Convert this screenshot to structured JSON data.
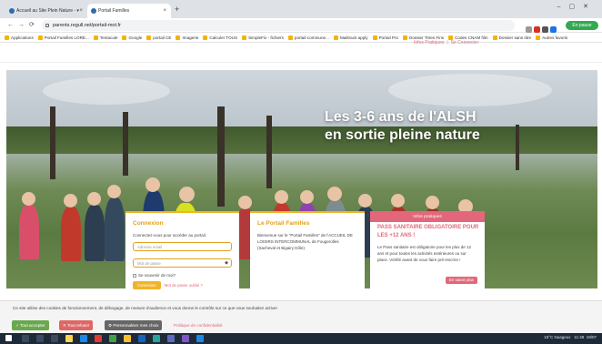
{
  "browser": {
    "tabs": [
      {
        "label": "Accueil au Site Plein Nature - ▾"
      },
      {
        "label": "Portail Familles"
      }
    ],
    "new_tab": "+",
    "url": "parents.regull.net/portail-mot.fr",
    "pause_label": "En pause",
    "bookmarks": [
      "Applications",
      "Portail Familles LORE...",
      "Tentacule",
      "Google",
      "portail CE",
      "Imagerie",
      "Calculer TOUS",
      "SimpleFix - fichiers",
      "portail-commune...",
      "Mailtrack apply",
      "Portail Pro",
      "Dossier Titres Fins",
      "Codes CNAM film",
      "Dossier sans titre",
      "Autres favoris"
    ]
  },
  "site": {
    "top_links": [
      "Infos Pratiques",
      "Se Connecter"
    ],
    "top_sep": "|",
    "hero_title_line1": "Les 3-6 ans de l'ALSH",
    "hero_title_line2": "en sortie pleine nature",
    "connexion": {
      "title": "Connexion",
      "desc": "Connectez-vous pour accéder au portail.",
      "email_placeholder": "Adresse email",
      "password_placeholder": "Mot de passe",
      "remember": "Se souvenir de moi?",
      "login_button": "Connexion",
      "forgot": "Mot de passe oublié ?"
    },
    "portail": {
      "title": "Le Portail Familles",
      "desc": "Bienvenue sur le \"Portail Familles\" de l'ACCUEIL DE LOISIRS INTERCOMMUNAL de Fougerolles (Sacheval et Bigairy Dôle)"
    },
    "infos": {
      "tag": "Infos pratiques",
      "title": "PASS SANITAIRE OBLIGATOIRE POUR LES +12 ANS !",
      "desc": "Le Pass sanitaire est obligatoire pour les plus de 12 ans et pour toutes les activités extérieures ou sur place. Vérifié avant de vous faire pré-inscrire !",
      "more_button": "En savoir plus"
    },
    "cookie": {
      "text": "Ce site utilise des cookies de fonctionnement, de débogage, de mesure d'audience et vous donne le contrôle sur ce que vous souhaitez activer",
      "accept": "✓ Tout accepter",
      "refuse": "✕ Tout refuser",
      "customize": "⚙ Personnaliser mes choix",
      "policy": "Politique de confidentialité"
    }
  },
  "taskbar": {
    "weather": "15°C Nuageux",
    "time": "11:48",
    "date": "19/07"
  },
  "colors": {
    "accent_yellow": "#f0b429",
    "accent_pink": "#e3677a"
  }
}
